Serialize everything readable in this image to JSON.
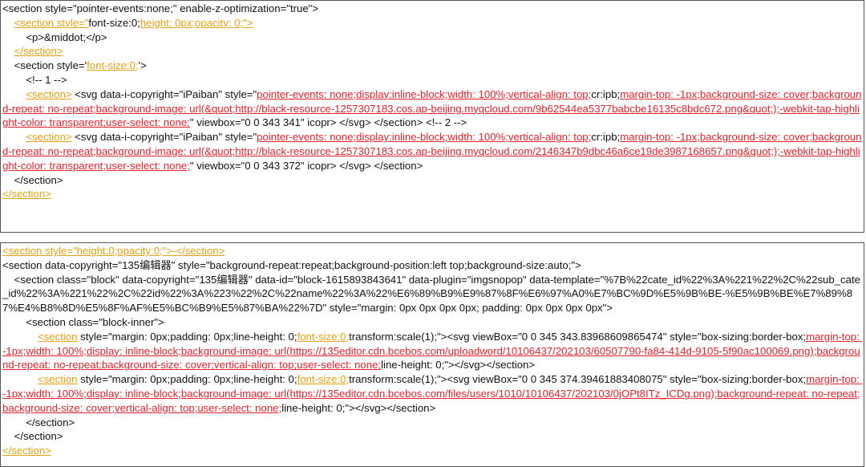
{
  "colors": {
    "orange": "#e8a110",
    "red": "#e8222a",
    "text": "#111111",
    "border": "#555555"
  },
  "top_panel": {
    "lines": [
      [
        {
          "t": "<section style=\"pointer-events:none;\" enable-z-optimization=\"true\">",
          "c": "n"
        }
      ],
      [
        {
          "t": "    ",
          "c": "n"
        },
        {
          "t": "<section style=\"",
          "c": "o"
        },
        {
          "t": "font-size:0;",
          "c": "n"
        },
        {
          "t": "height: 0px;opacity: 0;\">",
          "c": "o"
        }
      ],
      [
        {
          "t": "        <p>&middot;</p>",
          "c": "n"
        }
      ],
      [
        {
          "t": "    ",
          "c": "n"
        },
        {
          "t": "</section>",
          "c": "o"
        }
      ],
      [
        {
          "t": "    <section style='",
          "c": "n"
        },
        {
          "t": "font-size:0;",
          "c": "o"
        },
        {
          "t": "'>",
          "c": "n"
        }
      ],
      [
        {
          "t": "        <!-- 1 -->",
          "c": "n"
        }
      ],
      [
        {
          "t": "        ",
          "c": "n"
        },
        {
          "t": "<section>",
          "c": "o"
        },
        {
          "t": " <svg data-i-copyright=\"iPaiban\" style=\"",
          "c": "n"
        },
        {
          "t": "pointer-events: none;display:inline-block;width: 100%;vertical-align: top;",
          "c": "r"
        },
        {
          "t": "cr:ipb;",
          "c": "n"
        },
        {
          "t": "margin-top: -1px;background-size: cover;background-repeat: no-repeat;background-image: url(&quot;http://black-resource-1257307183.cos.ap-beijing.myqcloud.com/9b62544ea5377babcbe16135c8bdc672.png&quot;);-webkit-tap-highlight-color: transparent;user-select: none;",
          "c": "r"
        },
        {
          "t": "\" viewbox=\"0 0 343 341\" icopr> </svg> </section> <!-- 2 -->",
          "c": "n"
        }
      ],
      [
        {
          "t": "        ",
          "c": "n"
        },
        {
          "t": "<section>",
          "c": "o"
        },
        {
          "t": " <svg data-i-copyright=\"iPaiban\" style=\"",
          "c": "n"
        },
        {
          "t": "pointer-events: none;display:inline-block;width: 100%;vertical-align: top;",
          "c": "r"
        },
        {
          "t": "cr:ipb;",
          "c": "n"
        },
        {
          "t": "margin-top: -1px;background-size: cover;background-repeat: no-repeat;background-image: url(&quot;http://black-resource-1257307183.cos.ap-beijing.myqcloud.com/2146347b9dbc46a6ce19de3987168657.png&quot;);-webkit-tap-highlight-color: transparent;user-select: none;",
          "c": "r"
        },
        {
          "t": "\" viewbox=\"0 0 343 372\" icopr> </svg> </section>",
          "c": "n"
        }
      ],
      [
        {
          "t": "    </section>",
          "c": "n"
        }
      ],
      [
        {
          "t": "</section>",
          "c": "o"
        }
      ]
    ]
  },
  "bottom_panel": {
    "lines": [
      [
        {
          "t": "<section style=\"height:0;opacity:0;\">-</section>",
          "c": "o"
        }
      ],
      [
        {
          "t": "<section data-copyright=\"135编辑器\" style=\"background-repeat:repeat;background-position:left top;background-size:auto;\">",
          "c": "n"
        }
      ],
      [
        {
          "t": "    <section class=\"block\" data-copyright=\"135编辑器\" data-id=\"block-1615893843641\" data-plugin=\"imgsnopop\" data-template=\"%7B%22cate_id%22%3A%221%22%2C%22sub_cate_id%22%3A%221%22%2C%22id%22%3A%223%22%2C%22name%22%3A%22%E6%89%B9%E9%87%8F%E6%97%A0%E7%BC%9D%E5%9B%BE-%E5%9B%BE%E7%89%87%E4%B8%8D%E5%8F%AF%E5%BC%B9%E5%87%BA%22%7D\" style=\"margin: 0px 0px 0px 0px; padding: 0px 0px 0px 0px\">",
          "c": "n"
        }
      ],
      [
        {
          "t": "        <section class=\"block-inner\">",
          "c": "n"
        }
      ],
      [
        {
          "t": "            ",
          "c": "n"
        },
        {
          "t": "<section",
          "c": "o"
        },
        {
          "t": " style=\"margin: 0px;padding: 0px;line-height: 0;",
          "c": "n"
        },
        {
          "t": "font-size:0;",
          "c": "o"
        },
        {
          "t": "transform:scale(1);\"><svg viewBox=\"0 0 345 343.83968609865474\" style=\"box-sizing:border-box;",
          "c": "n"
        },
        {
          "t": "margin-top: -1px;width: 100%;display: inline-block;background-image: url(https://135editor.cdn.bcebos.com/uploadword/10106437/202103/60507790-fa84-414d-9105-5f90ac100069.png);background-repeat: no-repeat;background-size: cover;vertical-align: top;user-select: none;",
          "c": "r"
        },
        {
          "t": "line-height: 0;\"></svg></section>",
          "c": "n"
        }
      ],
      [
        {
          "t": "            ",
          "c": "n"
        },
        {
          "t": "<section",
          "c": "o"
        },
        {
          "t": " style=\"margin: 0px;padding: 0px;line-height: 0;",
          "c": "n"
        },
        {
          "t": "font-size:0;",
          "c": "o"
        },
        {
          "t": "transform:scale(1);\"><svg viewBox=\"0 0 345 374.39461883408075\" style=\"box-sizing:border-box;",
          "c": "n"
        },
        {
          "t": "margin-top: -1px;width: 100%;display: inline-block;background-image: url(https://135editor.cdn.bcebos.com/files/users/1010/10106437/202103/0jOPt8ITz_ICDg.png);background-repeat: no-repeat;background-size: cover;vertical-align: top;user-select: none;",
          "c": "r"
        },
        {
          "t": "line-height: 0;\"></svg></section>",
          "c": "n"
        }
      ],
      [
        {
          "t": "        </section>",
          "c": "n"
        }
      ],
      [
        {
          "t": "    </section>",
          "c": "n"
        }
      ],
      [
        {
          "t": "</section>",
          "c": "o"
        }
      ]
    ]
  }
}
